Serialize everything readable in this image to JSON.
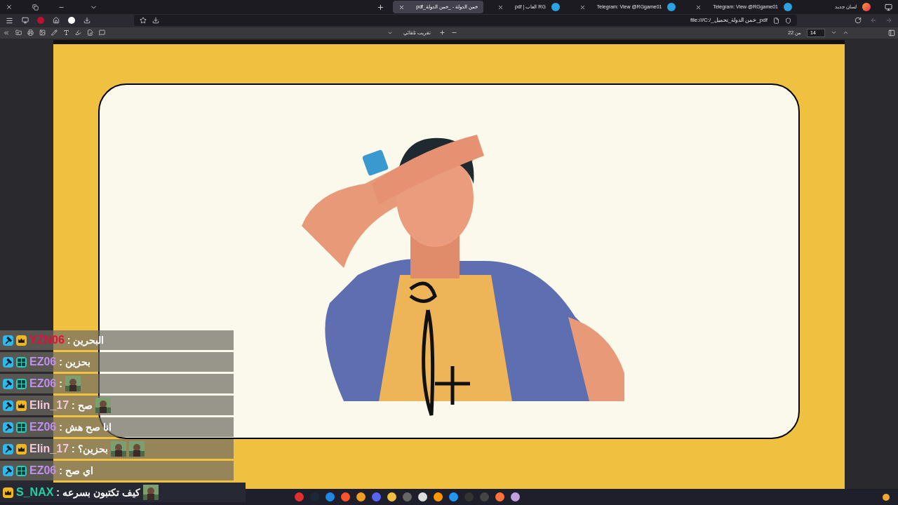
{
  "tabs": [
    {
      "title": "لسان جديد",
      "selected": false,
      "closable": false
    },
    {
      "title": "Telegram: View @RGgame01",
      "selected": false,
      "closable": true
    },
    {
      "title": "Telegram: View @RGgame01",
      "selected": false,
      "closable": true
    },
    {
      "title": "pdf | العاب RG",
      "selected": false,
      "closable": true
    },
    {
      "title": "خمن الدولة - _خمن الدولة_pdf",
      "selected": true,
      "closable": true
    }
  ],
  "address": {
    "url": "file:///C:/_خمن الدولة_تحميل_pdf"
  },
  "pdf_toolbar": {
    "page": "14",
    "page_count": "من 22",
    "zoom": "تقريب تلقائي"
  },
  "chat": [
    {
      "kind": "crown",
      "moderator": true,
      "name": "YZN06",
      "color": "#e0103a",
      "separator": ":",
      "message": "البحرين"
    },
    {
      "kind": "gg",
      "moderator": true,
      "name": "EZ06",
      "color": "#c08ff0",
      "separator": ":",
      "message": "بحزين"
    },
    {
      "kind": "gg",
      "moderator": true,
      "name": "EZ06",
      "color": "#c08ff0",
      "separator": ":"
    },
    {
      "kind": "crown",
      "moderator": true,
      "name": "Elin_17",
      "color": "#f4c8dc",
      "separator": ":",
      "message": "صح"
    },
    {
      "kind": "gg",
      "moderator": true,
      "name": "EZ06",
      "color": "#c08ff0",
      "separator": ":",
      "message": "انا صح هش"
    },
    {
      "kind": "crown",
      "moderator": true,
      "name": "Elin_17",
      "color": "#f4c8dc",
      "separator": ":",
      "message": "بحزين؟"
    },
    {
      "kind": "gg",
      "moderator": true,
      "name": "EZ06",
      "color": "#c08ff0",
      "separator": ":",
      "message": "اي صح"
    },
    {
      "kind": "crown",
      "moderator": false,
      "name": "S_NAX",
      "color": "#20d0a0",
      "separator": ":",
      "message": "كيف تكتبون بسرعه"
    }
  ]
}
